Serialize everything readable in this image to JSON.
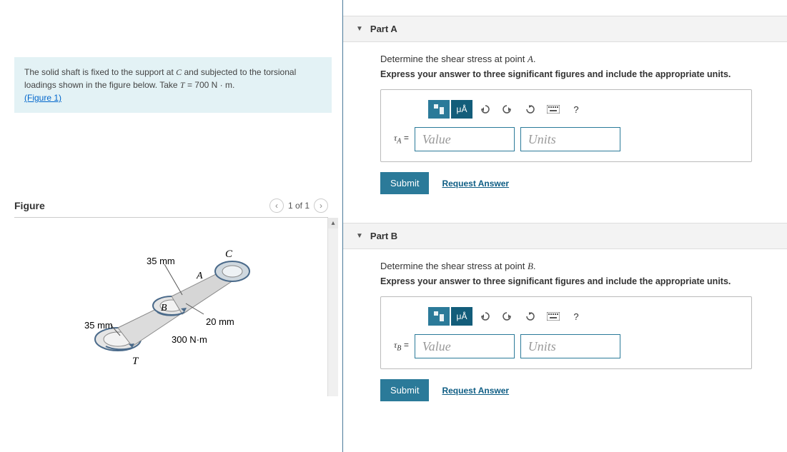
{
  "problem": {
    "text_prefix": "The solid shaft is fixed to the support at ",
    "point_c": "C",
    "text_mid": " and subjected to the torsional loadings shown in the figure below. Take ",
    "var_t": "T",
    "eq": " = 700 ",
    "unit": "N · m",
    "period": ".",
    "figure_link": "(Figure 1)"
  },
  "figure": {
    "title": "Figure",
    "counter": "1 of 1",
    "labels": {
      "c": "C",
      "a": "A",
      "b": "B",
      "t": "T",
      "r_top": "35 mm",
      "r_left": "35 mm",
      "r_small": "20 mm",
      "torque_mid": "300 N·m"
    }
  },
  "partA": {
    "header": "Part A",
    "prompt_prefix": "Determine the shear stress at point ",
    "point": "A",
    "prompt_suffix": ".",
    "instruction": "Express your answer to three significant figures and include the appropriate units.",
    "var_label_prefix": "τ",
    "var_label_sub": "A",
    "var_label_suffix": " = ",
    "value_placeholder": "Value",
    "units_placeholder": "Units",
    "submit": "Submit",
    "request": "Request Answer",
    "toolbar_mu": "μÅ",
    "help": "?"
  },
  "partB": {
    "header": "Part B",
    "prompt_prefix": "Determine the shear stress at point ",
    "point": "B",
    "prompt_suffix": ".",
    "instruction": "Express your answer to three significant figures and include the appropriate units.",
    "var_label_prefix": "τ",
    "var_label_sub": "B",
    "var_label_suffix": " = ",
    "value_placeholder": "Value",
    "units_placeholder": "Units",
    "submit": "Submit",
    "request": "Request Answer",
    "toolbar_mu": "μÅ",
    "help": "?"
  }
}
